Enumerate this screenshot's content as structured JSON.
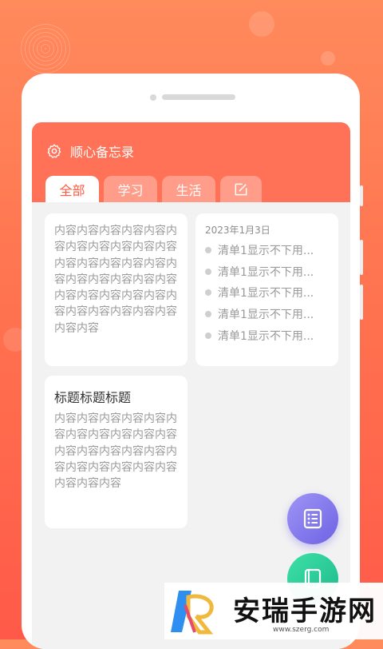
{
  "app": {
    "title": "顺心备忘录"
  },
  "tabs": [
    {
      "label": "全部",
      "active": true
    },
    {
      "label": "学习",
      "active": false
    },
    {
      "label": "生活",
      "active": false
    }
  ],
  "cards": [
    {
      "type": "note",
      "body": "内容内容内容内容内容内容内容内容内容内容内容内容内容内容内容内容内容内容内容内容内容内容内容内容内容内容内容内容内容内容内容内容内容内容内容"
    },
    {
      "type": "checklist",
      "date": "2023年1月3日",
      "items": [
        "清单1显示不下用...",
        "清单1显示不下用...",
        "清单1显示不下用...",
        "清单1显示不下用...",
        "清单1显示不下用..."
      ]
    },
    {
      "type": "titled-note",
      "title": "标题标题标题",
      "body": "内容内容内容内容内容内容内容内容内容内容内容内容内容内容内容内容内容内容内容内容内容内容内容内容内容"
    }
  ],
  "fabs": {
    "list_icon": "list-icon",
    "note_icon": "notebook-icon"
  },
  "icons": {
    "settings": "gear-icon",
    "edit": "edit-icon"
  },
  "watermark": {
    "name": "安瑞手游网",
    "url": "www.szerg.com"
  },
  "colors": {
    "accent": "#ff7257",
    "active_tab_text": "#ff5a42",
    "fab_purple": "#7b6fe8",
    "fab_green": "#2fcf99"
  }
}
